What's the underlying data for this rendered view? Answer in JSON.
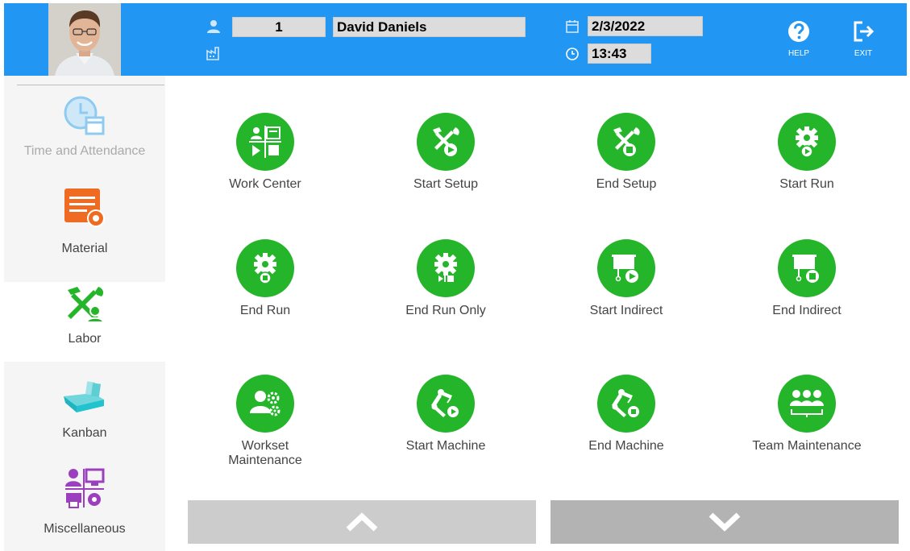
{
  "header": {
    "employee_id": "1",
    "employee_name": "David Daniels",
    "date": "2/3/2022",
    "time": "13:43",
    "help_label": "HELP",
    "exit_label": "EXIT"
  },
  "sidebar": {
    "items": [
      {
        "label": "Time and Attendance",
        "icon": "clock-calendar-icon"
      },
      {
        "label": "Material",
        "icon": "material-icon"
      },
      {
        "label": "Labor",
        "icon": "labor-tools-icon"
      },
      {
        "label": "Kanban",
        "icon": "kanban-bin-icon"
      },
      {
        "label": "Miscellaneous",
        "icon": "miscellaneous-icon"
      }
    ]
  },
  "actions": [
    {
      "label": "Work Center",
      "icon": "work-center-icon"
    },
    {
      "label": "Start Setup",
      "icon": "start-setup-icon"
    },
    {
      "label": "End Setup",
      "icon": "end-setup-icon"
    },
    {
      "label": "Start Run",
      "icon": "start-run-icon"
    },
    {
      "label": "End Run",
      "icon": "end-run-icon"
    },
    {
      "label": "End Run Only",
      "icon": "end-run-only-icon"
    },
    {
      "label": "Start Indirect",
      "icon": "start-indirect-icon"
    },
    {
      "label": "End Indirect",
      "icon": "end-indirect-icon"
    },
    {
      "label": "Workset\nMaintenance",
      "icon": "workset-maintenance-icon"
    },
    {
      "label": "Start Machine",
      "icon": "start-machine-icon"
    },
    {
      "label": "End Machine",
      "icon": "end-machine-icon"
    },
    {
      "label": "Team Maintenance",
      "icon": "team-maintenance-icon"
    }
  ],
  "colors": {
    "header": "#2196F3",
    "action_green": "#25b52a",
    "sidebar_bg": "#f5f5f5",
    "sidebar_active_bg": "#ffffff",
    "nav_up": "#cccccc",
    "nav_down": "#b3b3b3"
  }
}
